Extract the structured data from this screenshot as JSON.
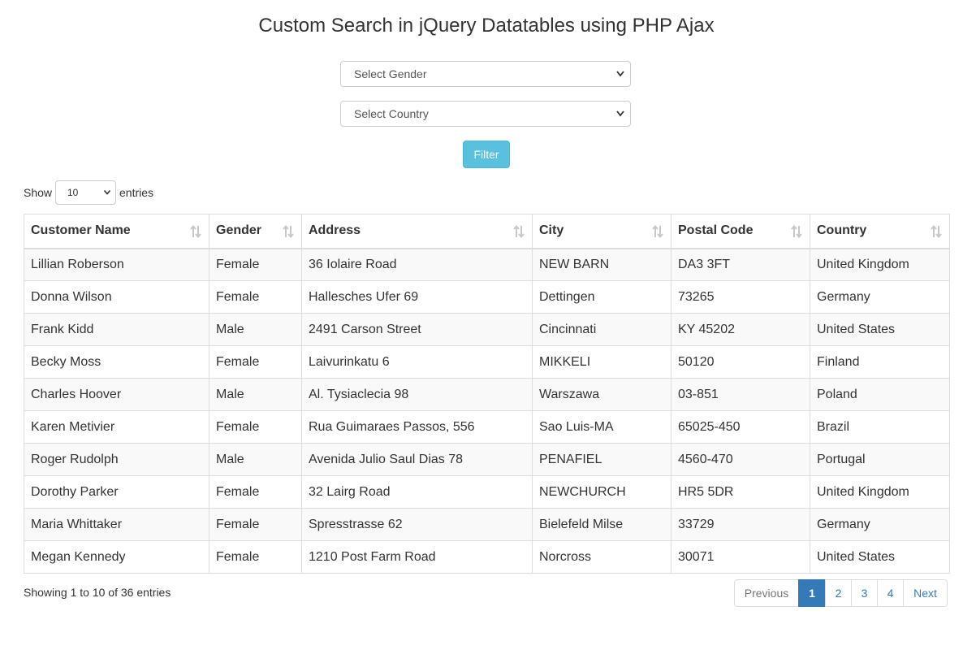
{
  "page": {
    "title": "Custom Search in jQuery Datatables using PHP Ajax"
  },
  "filters": {
    "gender_placeholder": "Select Gender",
    "country_placeholder": "Select Country",
    "filter_button": "Filter"
  },
  "length_menu": {
    "show_label": "Show",
    "value": "10",
    "entries_label": "entries"
  },
  "table": {
    "columns": [
      "Customer Name",
      "Gender",
      "Address",
      "City",
      "Postal Code",
      "Country"
    ],
    "rows": [
      [
        "Lillian Roberson",
        "Female",
        "36 Iolaire Road",
        "NEW BARN",
        "DA3 3FT",
        "United Kingdom"
      ],
      [
        "Donna Wilson",
        "Female",
        "Hallesches Ufer 69",
        "Dettingen",
        "73265",
        "Germany"
      ],
      [
        "Frank Kidd",
        "Male",
        "2491 Carson Street",
        "Cincinnati",
        "KY 45202",
        "United States"
      ],
      [
        "Becky Moss",
        "Female",
        "Laivurinkatu 6",
        "MIKKELI",
        "50120",
        "Finland"
      ],
      [
        "Charles Hoover",
        "Male",
        "Al. Tysiaclecia 98",
        "Warszawa",
        "03-851",
        "Poland"
      ],
      [
        "Karen Metivier",
        "Female",
        "Rua Guimaraes Passos, 556",
        "Sao Luis-MA",
        "65025-450",
        "Brazil"
      ],
      [
        "Roger Rudolph",
        "Male",
        "Avenida Julio Saul Dias 78",
        "PENAFIEL",
        "4560-470",
        "Portugal"
      ],
      [
        "Dorothy Parker",
        "Female",
        "32 Lairg Road",
        "NEWCHURCH",
        "HR5 5DR",
        "United Kingdom"
      ],
      [
        "Maria Whittaker",
        "Female",
        "Spresstrasse 62",
        "Bielefeld Milse",
        "33729",
        "Germany"
      ],
      [
        "Megan Kennedy",
        "Female",
        "1210 Post Farm Road",
        "Norcross",
        "30071",
        "United States"
      ]
    ]
  },
  "footer": {
    "info": "Showing 1 to 10 of 36 entries"
  },
  "pagination": {
    "previous": "Previous",
    "pages": [
      "1",
      "2",
      "3",
      "4"
    ],
    "next": "Next",
    "active_page": "1"
  },
  "colors": {
    "filter_button": "#5bc0de",
    "active_page": "#337ab7",
    "link": "#337ab7"
  }
}
